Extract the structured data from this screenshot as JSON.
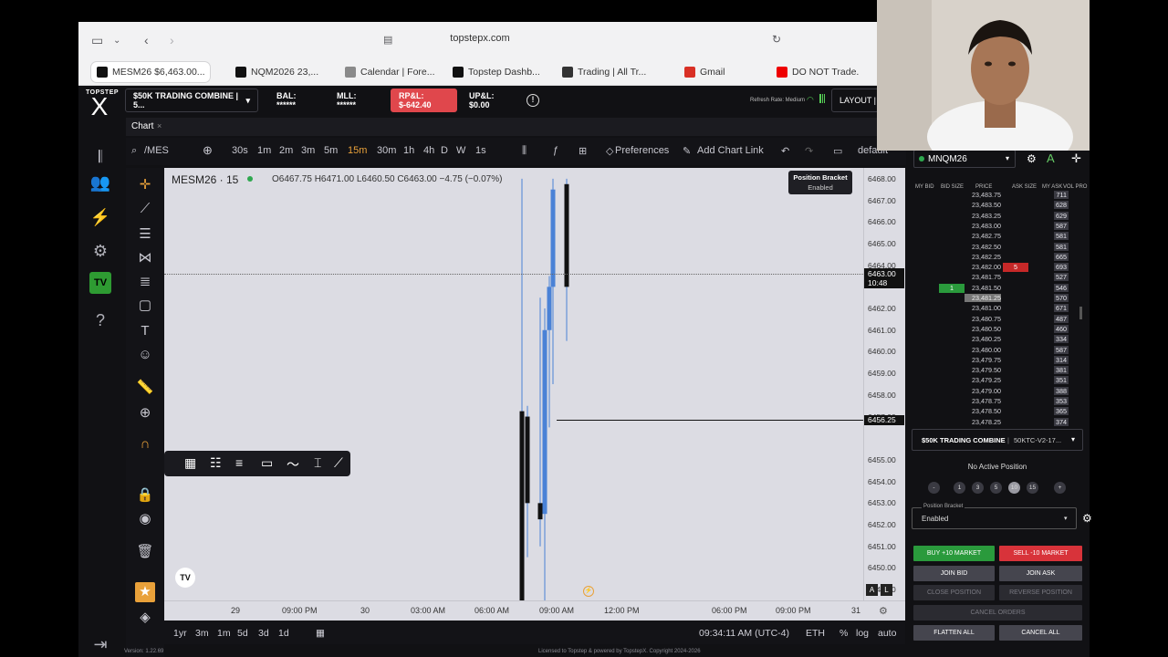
{
  "browser": {
    "url": "topstepx.com",
    "tabs": [
      {
        "label": "MESM26 $6,463.00...",
        "icon": "topstep-icon",
        "color": "#111"
      },
      {
        "label": "NQM2026 23,...",
        "icon": "tradingview-icon",
        "color": "#111"
      },
      {
        "label": "Calendar | Fore...",
        "icon": "forexfactory-icon",
        "color": "#8a8a8a"
      },
      {
        "label": "Topstep Dashb...",
        "icon": "topstep-icon",
        "color": "#111"
      },
      {
        "label": "Trading | All Tr...",
        "icon": "notion-icon",
        "color": "#333"
      },
      {
        "label": "Gmail",
        "icon": "gmail-icon",
        "color": "#d93025"
      },
      {
        "label": "DO NOT Trade...",
        "icon": "youtube-icon",
        "color": "#e00"
      }
    ]
  },
  "app": {
    "logo_small": "TOPSTEP",
    "logo_big": "X",
    "account": "$50K TRADING COMBINE | 5...",
    "bal": "BAL: ******",
    "mll": "MLL: ******",
    "rpl": "RP&L: $-642.40",
    "upl": "UP&L: $0.00",
    "refresh": "Refresh Rate: Medium",
    "layout": "LAYOUT | d"
  },
  "chart": {
    "tab_label": "Chart",
    "symbol_search": "/MES",
    "timeframes": [
      "30s",
      "1m",
      "2m",
      "3m",
      "5m",
      "15m",
      "30m",
      "1h",
      "4h",
      "D",
      "W",
      "1s"
    ],
    "active_timeframe": "15m",
    "preferences": "Preferences",
    "add_chart_link": "Add Chart Link",
    "layout_name": "default",
    "title": "MESM26 · 15",
    "ohlc": "O6467.75 H6471.00 L6460.50 C6463.00 −4.75 (−0.07%)",
    "position_bracket": "Position Bracket",
    "position_bracket_state": "Enabled",
    "current_price": "6463.00",
    "countdown": "10:48",
    "line_price": "6456.25",
    "price_labels": [
      "6468.00",
      "6467.00",
      "6466.00",
      "6465.00",
      "6464.00",
      "6462.00",
      "6461.00",
      "6460.00",
      "6459.00",
      "6458.00",
      "6457.00",
      "6455.00",
      "6454.00",
      "6453.00",
      "6452.00",
      "6451.00",
      "6450.00",
      "6449.00"
    ],
    "time_labels": [
      "29",
      "09:00 PM",
      "30",
      "03:00 AM",
      "06:00 AM",
      "09:00 AM",
      "12:00 PM",
      "06:00 PM",
      "09:00 PM",
      "31"
    ],
    "ranges": [
      "1yr",
      "3m",
      "1m",
      "5d",
      "3d",
      "1d"
    ],
    "clock": "09:34:11 AM (UTC-4)",
    "session": "ETH",
    "pct": "%",
    "log": "log",
    "auto": "auto",
    "axis_a": "A",
    "axis_l": "L",
    "chart_data": {
      "type": "candlestick",
      "ylim": [
        6448.5,
        6468.5
      ],
      "candles": [
        {
          "o": 6457.25,
          "h": 6468.0,
          "l": 6448.5,
          "c": 6448.5
        },
        {
          "o": 6457.0,
          "h": 6457.5,
          "l": 6450.5,
          "c": 6453.0
        },
        {
          "o": 6453.0,
          "h": 6462.5,
          "l": 6451.0,
          "c": 6452.25
        },
        {
          "o": 6452.5,
          "h": 6462.0,
          "l": 6448.5,
          "c": 6461.0
        },
        {
          "o": 6461.0,
          "h": 6463.5,
          "l": 6456.5,
          "c": 6463.0
        },
        {
          "o": 6463.0,
          "h": 6468.0,
          "l": 6458.5,
          "c": 6467.5
        },
        {
          "o": 6467.75,
          "h": 6468.0,
          "l": 6460.5,
          "c": 6463.0
        }
      ]
    }
  },
  "dom": {
    "symbol": "MNQM26",
    "headers": [
      "MY BID",
      "BID SIZE",
      "PRICE",
      "ASK SIZE",
      "MY ASK",
      "VOL PRO"
    ],
    "rows": [
      {
        "price": "23,483.75",
        "vol": "711"
      },
      {
        "price": "23,483.50",
        "vol": "628"
      },
      {
        "price": "23,483.25",
        "vol": "629"
      },
      {
        "price": "23,483.00",
        "vol": "587"
      },
      {
        "price": "23,482.75",
        "vol": "581"
      },
      {
        "price": "23,482.50",
        "vol": "581"
      },
      {
        "price": "23,482.25",
        "vol": "665"
      },
      {
        "price": "23,482.00",
        "vol": "693",
        "ask": "5"
      },
      {
        "price": "23,481.75",
        "vol": "527"
      },
      {
        "price": "23,481.50",
        "vol": "546",
        "bid": "1"
      },
      {
        "price": "23,481.25",
        "vol": "570"
      },
      {
        "price": "23,481.00",
        "vol": "671"
      },
      {
        "price": "23,480.75",
        "vol": "487"
      },
      {
        "price": "23,480.50",
        "vol": "460"
      },
      {
        "price": "23,480.25",
        "vol": "334"
      },
      {
        "price": "23,480.00",
        "vol": "587"
      },
      {
        "price": "23,479.75",
        "vol": "314"
      },
      {
        "price": "23,479.50",
        "vol": "381"
      },
      {
        "price": "23,479.25",
        "vol": "351"
      },
      {
        "price": "23,479.00",
        "vol": "388"
      },
      {
        "price": "23,478.75",
        "vol": "353"
      },
      {
        "price": "23,478.50",
        "vol": "365"
      },
      {
        "price": "23,478.25",
        "vol": "374"
      }
    ],
    "account": "$50K TRADING COMBINE",
    "account_id": "50KTC-V2-17...",
    "no_position": "No Active Position",
    "qty_buttons": [
      "-",
      "1",
      "3",
      "5",
      "10",
      "15",
      "+"
    ],
    "bracket_label": "Position Bracket",
    "bracket_value": "Enabled",
    "buy": "BUY +10 MARKET",
    "sell": "SELL -10 MARKET",
    "join_bid": "JOIN BID",
    "join_ask": "JOIN ASK",
    "close_pos": "CLOSE POSITION",
    "reverse_pos": "REVERSE POSITION",
    "cancel_orders": "CANCEL ORDERS",
    "flatten": "FLATTEN ALL",
    "cancel_all": "CANCEL ALL"
  },
  "footer": {
    "version": "Version: 1.22.69",
    "copyright": "Licensed to Topstep & powered by TopstepX. Copyright 2024-2026"
  }
}
